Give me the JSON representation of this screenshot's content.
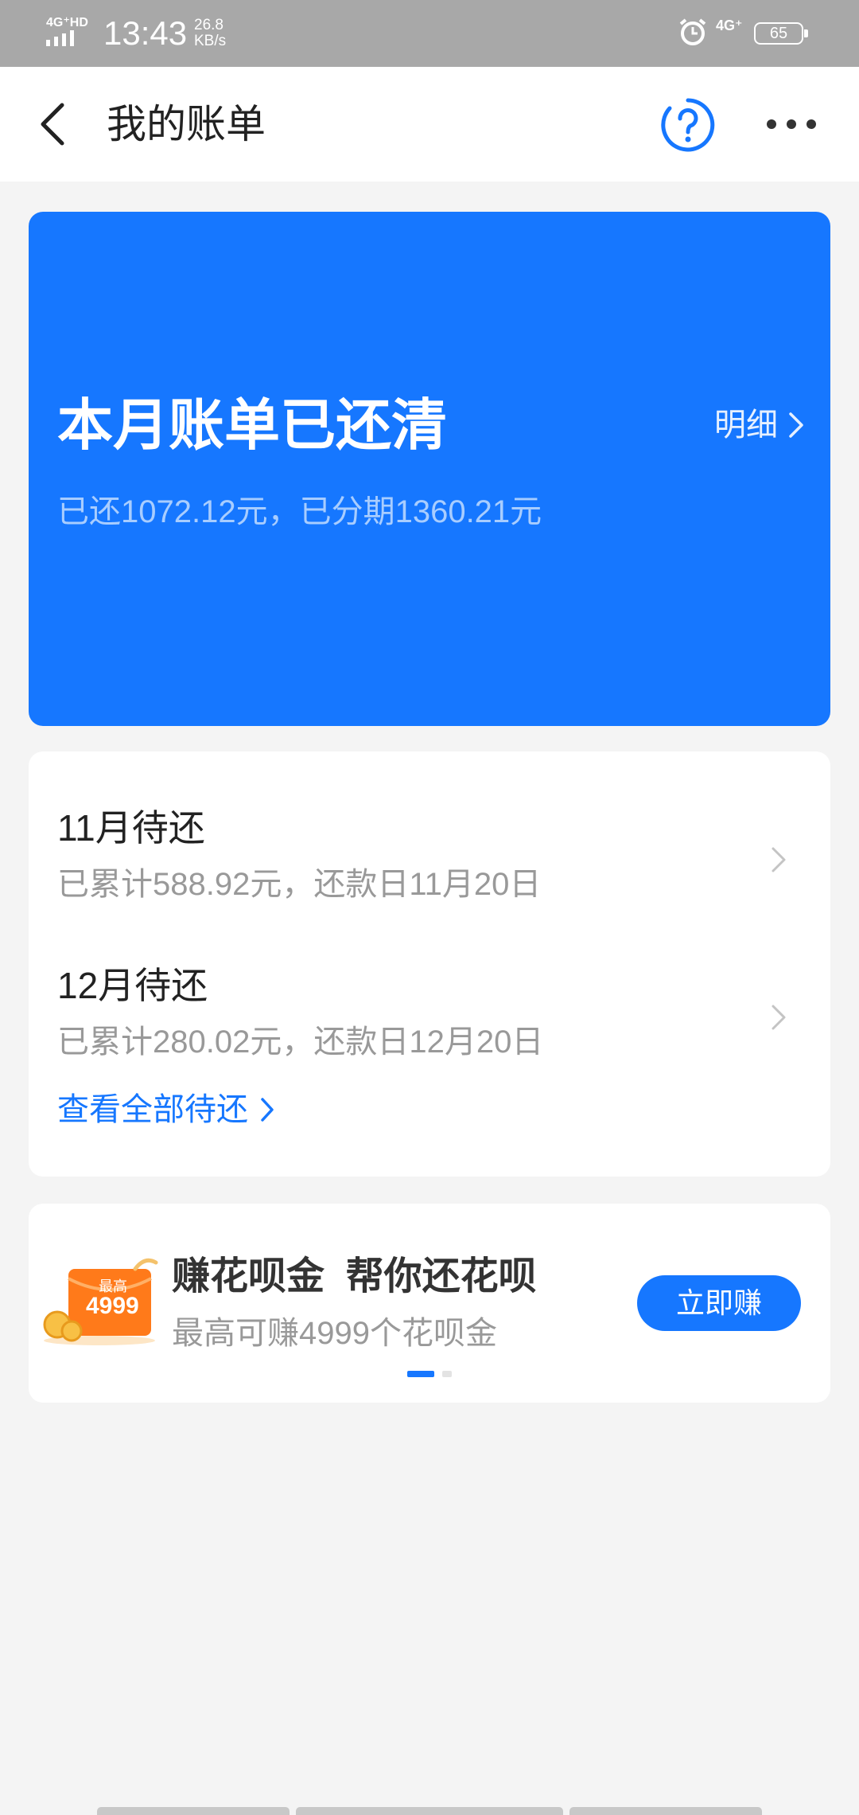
{
  "status_bar": {
    "network": "4G⁺HD",
    "time": "13:43",
    "speed_value": "26.8",
    "speed_unit": "KB/s",
    "network_right": "4G⁺",
    "battery": "65"
  },
  "header": {
    "title": "我的账单"
  },
  "bill_card": {
    "title": "本月账单已还清",
    "summary": "已还1072.12元，已分期1360.21元",
    "detail_label": "明细",
    "background": "#1677ff"
  },
  "pending": {
    "items": [
      {
        "title": "11月待还",
        "subtitle": "已累计588.92元，还款日11月20日"
      },
      {
        "title": "12月待还",
        "subtitle": "已累计280.02元，还款日12月20日"
      }
    ],
    "view_all_label": "查看全部待还"
  },
  "promo": {
    "badge_top": "最高",
    "badge_amount": "4999",
    "title": "赚花呗金  帮你还花呗",
    "subtitle": "最高可赚4999个花呗金",
    "button_label": "立即赚"
  },
  "colors": {
    "accent": "#1677ff",
    "page_bg": "#f4f4f4"
  }
}
